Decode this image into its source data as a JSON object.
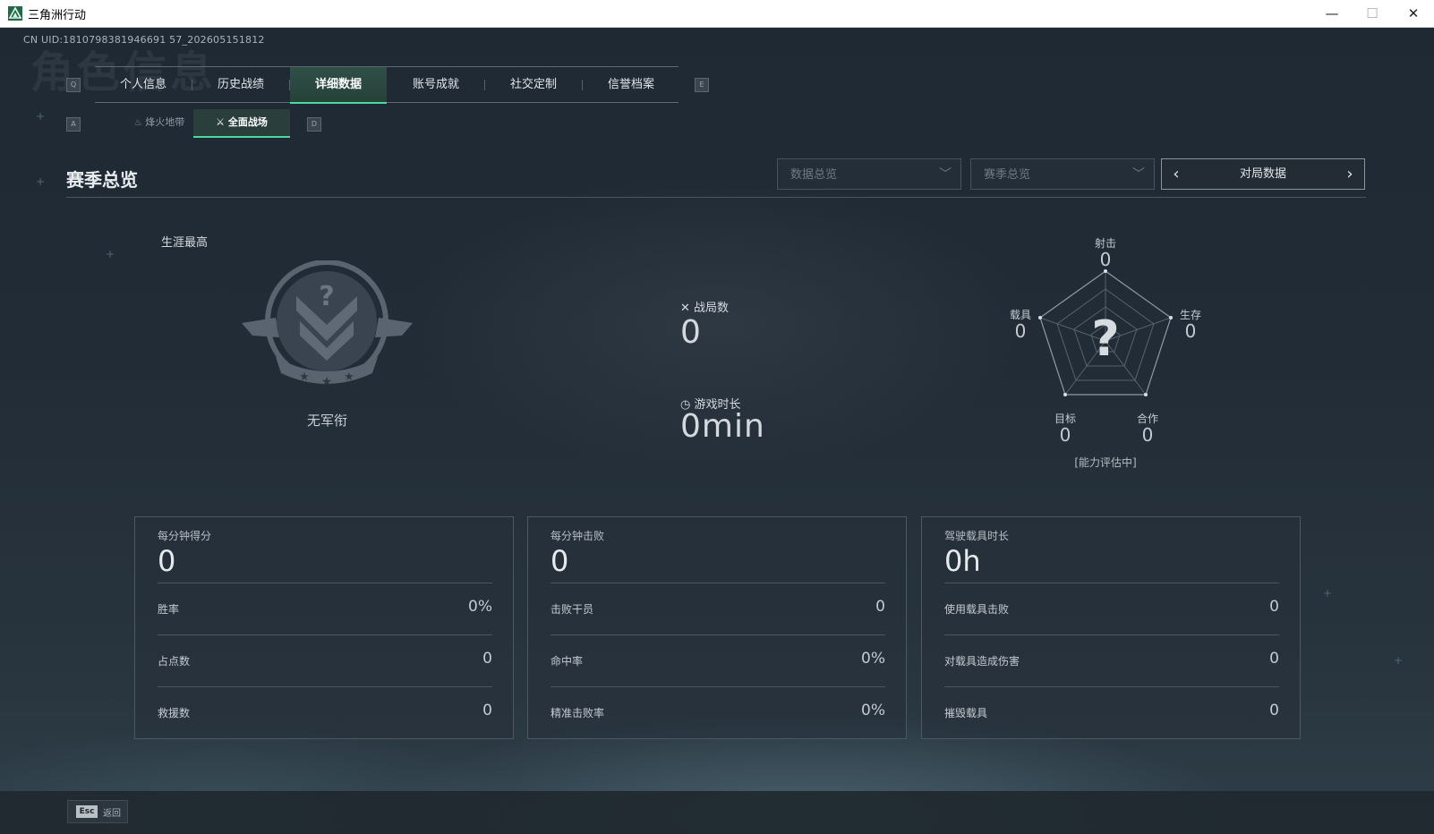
{
  "window": {
    "title": "三角洲行动",
    "minimize": "—",
    "maximize": "☐",
    "close": "✕"
  },
  "uid_text": "CN UID:1810798381946691 57_202605151812",
  "watermark": "角色信息",
  "keycaps": {
    "prev_tab": "Q",
    "next_tab": "E",
    "prev_sub": "A",
    "next_sub": "D"
  },
  "tabs": [
    {
      "label": "个人信息"
    },
    {
      "label": "历史战绩"
    },
    {
      "label": "详细数据"
    },
    {
      "label": "账号成就"
    },
    {
      "label": "社交定制"
    },
    {
      "label": "信誉档案"
    }
  ],
  "subtabs": [
    {
      "label": "烽火地带",
      "icon": "campfire-icon"
    },
    {
      "label": "全面战场",
      "icon": "battlefield-icon"
    }
  ],
  "section_title": "赛季总览",
  "filters": {
    "data_overview": "数据总览",
    "season_overview": "赛季总览",
    "match_data": "对局数据"
  },
  "career": {
    "label": "生涯最高",
    "rank_name": "无军衔"
  },
  "summary": {
    "matches_label": "战局数",
    "matches_value": "0",
    "playtime_label": "游戏时长",
    "playtime_value": "0min"
  },
  "radar": {
    "center_symbol": "?",
    "status": "[能力评估中]",
    "axes": [
      {
        "label": "射击",
        "value": "0"
      },
      {
        "label": "生存",
        "value": "0"
      },
      {
        "label": "合作",
        "value": "0"
      },
      {
        "label": "目标",
        "value": "0"
      },
      {
        "label": "载具",
        "value": "0"
      }
    ]
  },
  "cards": [
    {
      "head_label": "每分钟得分",
      "head_value": "0",
      "rows": [
        {
          "label": "胜率",
          "value": "0%"
        },
        {
          "label": "占点数",
          "value": "0"
        },
        {
          "label": "救援数",
          "value": "0"
        }
      ]
    },
    {
      "head_label": "每分钟击败",
      "head_value": "0",
      "rows": [
        {
          "label": "击败干员",
          "value": "0"
        },
        {
          "label": "命中率",
          "value": "0%"
        },
        {
          "label": "精准击败率",
          "value": "0%"
        }
      ]
    },
    {
      "head_label": "驾驶载具时长",
      "head_value": "0h",
      "rows": [
        {
          "label": "使用载具击败",
          "value": "0"
        },
        {
          "label": "对载具造成伤害",
          "value": "0"
        },
        {
          "label": "摧毁载具",
          "value": "0"
        }
      ]
    }
  ],
  "footer": {
    "esc_key": "Esc",
    "back_label": "返回"
  },
  "colors": {
    "accent": "#4bd9a1",
    "background": "#1c2530"
  }
}
